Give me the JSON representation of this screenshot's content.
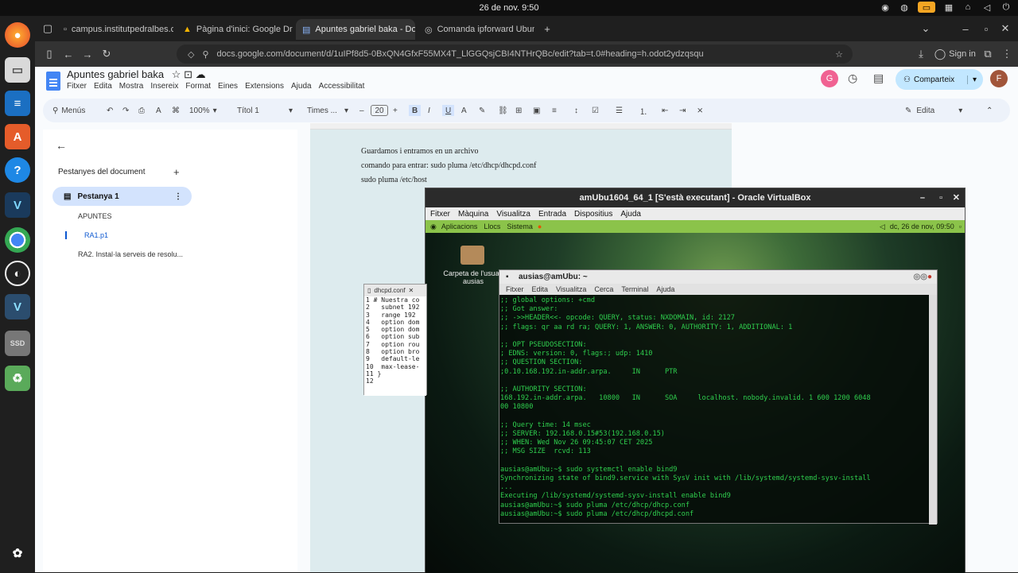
{
  "topbar": {
    "clock": "26 de nov.  9:50"
  },
  "browser": {
    "tabs": [
      {
        "label": "campus.institutpedralbes.cat"
      },
      {
        "label": "Pàgina d'inici: Google Drive"
      },
      {
        "label": "Apuntes gabriel baka - Docs"
      },
      {
        "label": "Comanda ipforward Ubuntu"
      }
    ],
    "url": "docs.google.com/document/d/1uIPf8d5-0BxQN4GfxF55MX4T_LlGGQsjCBI4NTHrQBc/edit?tab=t.0#heading=h.odot2ydzqsqu",
    "signin": "Sign in"
  },
  "docs": {
    "title": "Apuntes gabriel baka",
    "menu": [
      "Fitxer",
      "Edita",
      "Mostra",
      "Insereix",
      "Format",
      "Eines",
      "Extensions",
      "Ajuda",
      "Accessibilitat"
    ],
    "share": "Comparteix",
    "avatar_g": "G",
    "avatar_f": "F",
    "toolbar": {
      "menus": "Menús",
      "zoom": "100%",
      "style": "Títol 1",
      "font": "Times ...",
      "size": "20",
      "edit": "Edita"
    },
    "sidebar": {
      "heading": "Pestanyes del document",
      "tab": "Pestanya 1",
      "items": [
        "APUNTES",
        "RA1.p1",
        "RA2. Instal·la serveis de resolu..."
      ]
    },
    "page_lines": [
      "Guardamos i entramos en un archivo",
      "comando para entrar: sudo pluma /etc/dhcp/dhcpd.conf",
      "sudo pluma /etc/host"
    ]
  },
  "vbox": {
    "title": "amUbu1604_64_1 [S'està executant] - Oracle VirtualBox",
    "menu": [
      "Fitxer",
      "Màquina",
      "Visualitza",
      "Entrada",
      "Dispositius",
      "Ajuda"
    ],
    "guest_panel": {
      "apps": "Aplicacions",
      "places": "Llocs",
      "system": "Sistema",
      "clock": "dc, 26 de nov, 09:50"
    },
    "desktop_icon": "Carpeta de l'usuari ausias",
    "gedit_tab": "dhcpd.conf",
    "gedit_lines": [
      "1 # Nuestra co",
      "2   subnet 192",
      "3   range 192",
      "4   option dom",
      "5   option dom",
      "6   option sub",
      "7   option rou",
      "8   option bro",
      "9   default-le",
      "10  max-lease-",
      "11 }",
      "12"
    ],
    "terminal_title": "ausias@amUbu: ~",
    "terminal_menu": [
      "Fitxer",
      "Edita",
      "Visualitza",
      "Cerca",
      "Terminal",
      "Ajuda"
    ],
    "terminal_lines": [
      ";; global options: +cmd",
      ";; Got answer:",
      ";; ->>HEADER<<- opcode: QUERY, status: NXDOMAIN, id: 2127",
      ";; flags: qr aa rd ra; QUERY: 1, ANSWER: 0, AUTHORITY: 1, ADDITIONAL: 1",
      "",
      ";; OPT PSEUDOSECTION:",
      "; EDNS: version: 0, flags:; udp: 1410",
      ";; QUESTION SECTION:",
      ";0.10.168.192.in-addr.arpa.     IN      PTR",
      "",
      ";; AUTHORITY SECTION:",
      "168.192.in-addr.arpa.   10800   IN      SOA     localhost. nobody.invalid. 1 600 1200 6048",
      "00 10800",
      "",
      ";; Query time: 14 msec",
      ";; SERVER: 192.168.0.15#53(192.168.0.15)",
      ";; WHEN: Wed Nov 26 09:45:07 CET 2025",
      ";; MSG SIZE  rcvd: 113",
      "",
      "ausias@amUbu:~$ sudo systemctl enable bind9",
      "Synchronizing state of bind9.service with SysV init with /lib/systemd/systemd-sysv-install",
      "...",
      "Executing /lib/systemd/systemd-sysv-install enable bind9",
      "ausias@amUbu:~$ sudo pluma /etc/dhcp/dhcp.conf",
      "ausias@amUbu:~$ sudo pluma /etc/dhcp/dhcpd.conf"
    ]
  },
  "colors": {
    "docs_blue": "#4285f4",
    "terminal_green": "#2fcf4e",
    "guest_panel": "#8bc34a"
  }
}
